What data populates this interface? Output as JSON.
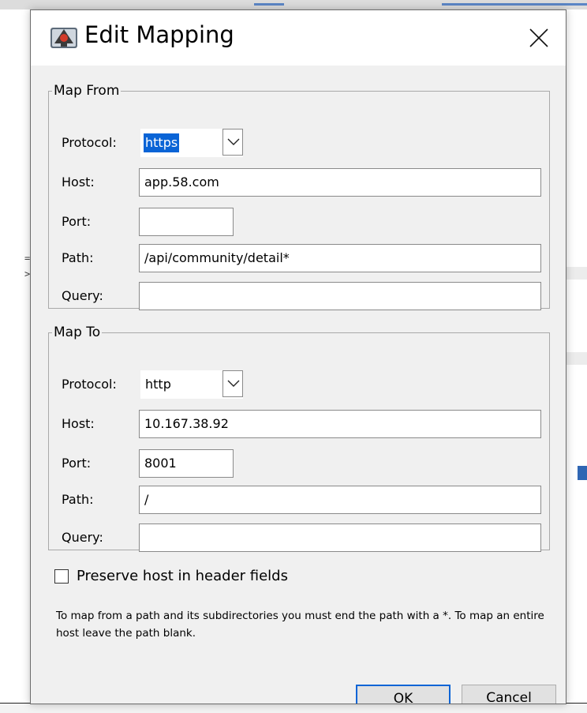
{
  "dialog": {
    "title": "Edit Mapping",
    "icon": "charles-app-icon",
    "close_icon": "close-icon"
  },
  "map_from": {
    "legend": "Map From",
    "protocol": {
      "label": "Protocol:",
      "value": "https",
      "selected": true
    },
    "host": {
      "label": "Host:",
      "value": "app.58.com"
    },
    "port": {
      "label": "Port:",
      "value": ""
    },
    "path": {
      "label": "Path:",
      "value": "/api/community/detail*"
    },
    "query": {
      "label": "Query:",
      "value": ""
    }
  },
  "map_to": {
    "legend": "Map To",
    "protocol": {
      "label": "Protocol:",
      "value": "http"
    },
    "host": {
      "label": "Host:",
      "value": "10.167.38.92"
    },
    "port": {
      "label": "Port:",
      "value": "8001"
    },
    "path": {
      "label": "Path:",
      "value": "/"
    },
    "query": {
      "label": "Query:",
      "value": ""
    }
  },
  "preserve_host": {
    "label": "Preserve host in header fields",
    "checked": false
  },
  "help_text": "To map from a path and its subdirectories you must end the path with a *. To map an entire host leave the path blank.",
  "buttons": {
    "ok": "OK",
    "cancel": "Cancel"
  },
  "colors": {
    "selection": "#0a64d6",
    "dialog_bg": "#f0f0f0",
    "titlebar_bg": "#ffffff"
  }
}
